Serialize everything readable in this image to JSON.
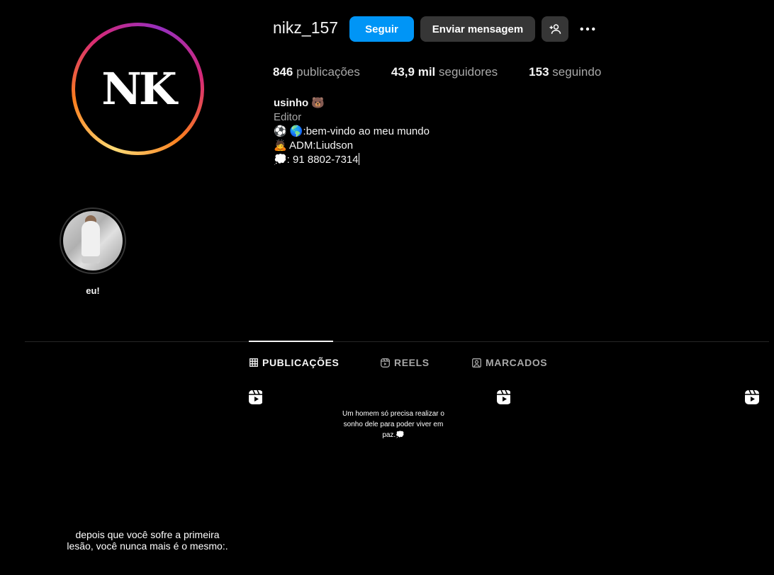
{
  "profile": {
    "username": "nikz_157",
    "avatar_logo": "NK"
  },
  "actions": {
    "follow_label": "Seguir",
    "message_label": "Enviar mensagem",
    "add_user_icon": "person-plus-icon",
    "more_icon": "more-options-icon"
  },
  "stats": {
    "posts_count": "846",
    "posts_label": "publicações",
    "followers_count": "43,9 mil",
    "followers_label": "seguidores",
    "following_count": "153",
    "following_label": "seguindo"
  },
  "bio": {
    "name": "usinho 🐻",
    "category": "Editor",
    "line1": "⚽ 🌎:bem-vindo ao meu mundo",
    "line2": "🙇 ADM:Liudson",
    "line3": "💭: 91 8802-7314"
  },
  "highlights": [
    {
      "label": "eu!"
    }
  ],
  "tabs": [
    {
      "label": "PUBLICAÇÕES",
      "icon": "grid-icon",
      "active": true
    },
    {
      "label": "REELS",
      "icon": "reels-icon",
      "active": false
    },
    {
      "label": "MARCADOS",
      "icon": "tagged-icon",
      "active": false
    }
  ],
  "posts": [
    {
      "caption": "depois que você sofre a primeira lesão, você nunca mais é o mesmo:.",
      "type_icon": "reel-icon"
    },
    {
      "caption": "Um homem só precisa realizar o sonho dele para poder viver em paz.💭",
      "type_icon": "reel-icon"
    },
    {
      "caption": "",
      "type_icon": "reel-icon"
    }
  ],
  "colors": {
    "background": "#000000",
    "follow_button": "#0095f6",
    "secondary_button": "#363636",
    "muted_text": "#a8a8a8"
  }
}
